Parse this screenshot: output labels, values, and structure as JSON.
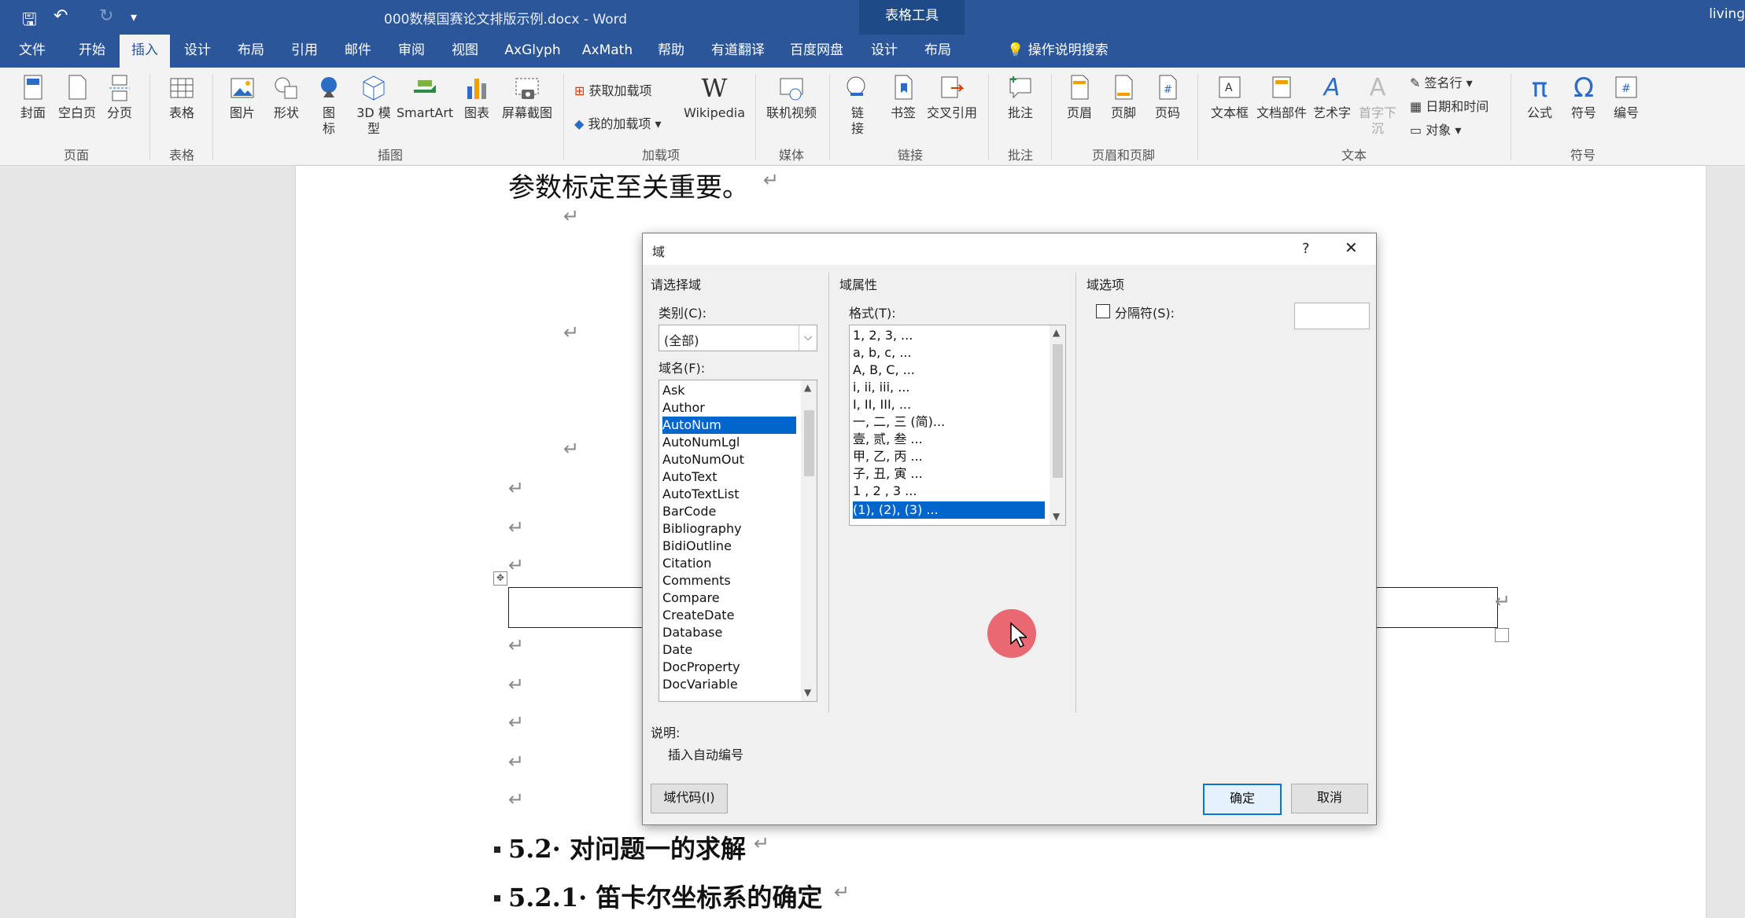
{
  "window": {
    "title": "000数模国赛论文排版示例.docx  -  Word",
    "context_tools": "表格工具",
    "user": "living"
  },
  "tabs": [
    "文件",
    "开始",
    "插入",
    "设计",
    "布局",
    "引用",
    "邮件",
    "审阅",
    "视图",
    "AxGlyph",
    "AxMath",
    "帮助",
    "有道翻译",
    "百度网盘",
    "设计",
    "布局"
  ],
  "active_tab": "插入",
  "tell_me": "操作说明搜索",
  "ribbon": {
    "cover": "封面",
    "blank_page": "空白页",
    "page_break": "分页",
    "table": "表格",
    "picture": "图片",
    "shapes": "形状",
    "icons": "图\n标",
    "models3d": "3D 模\n型",
    "smartart": "SmartArt",
    "chart": "图表",
    "screenshot": "屏幕截图",
    "get_addins": "获取加载项",
    "my_addins": "我的加载项",
    "wikipedia": "Wikipedia",
    "online_video": "联机视频",
    "link": "链\n接",
    "bookmark": "书签",
    "cross_ref": "交叉引用",
    "comment": "批注",
    "header": "页眉",
    "footer": "页脚",
    "page_number": "页码",
    "textbox": "文本框",
    "quick_parts": "文档部件",
    "wordart": "艺术字",
    "dropcap": "首字下沉",
    "signature_line": "签名行",
    "date_time": "日期和时间",
    "object": "对象",
    "equation": "公式",
    "symbol": "符号",
    "number": "编号",
    "groups": [
      "页面",
      "表格",
      "插图",
      "加载项",
      "媒体",
      "链接",
      "批注",
      "页眉和页脚",
      "文本",
      "符号"
    ]
  },
  "document": {
    "line1": "参数标定至关重要。",
    "heading1": "5.2· 对问题一的求解",
    "heading2": "5.2.1· 笛卡尔坐标系的确定"
  },
  "dialog": {
    "title": "域",
    "help": "?",
    "close": "✕",
    "choose_field": "请选择域",
    "category_label": "类别(C):",
    "category_value": "(全部)",
    "field_names_label": "域名(F):",
    "field_names": [
      "Ask",
      "Author",
      "AutoNum",
      "AutoNumLgl",
      "AutoNumOut",
      "AutoText",
      "AutoTextList",
      "BarCode",
      "Bibliography",
      "BidiOutline",
      "Citation",
      "Comments",
      "Compare",
      "CreateDate",
      "Database",
      "Date",
      "DocProperty",
      "DocVariable"
    ],
    "selected_field": "AutoNum",
    "field_props": "域属性",
    "format_label": "格式(T):",
    "formats": [
      "1, 2, 3, ...",
      "a, b, c, ...",
      "A, B, C, ...",
      "i, ii, iii, ...",
      "I, II, III, ...",
      "一, 二, 三 (简)...",
      "壹, 贰, 叁 ...",
      "甲, 乙, 丙 ...",
      "子, 丑, 寅 ...",
      "1 , 2 , 3  ...",
      "(1), (2), (3) ..."
    ],
    "selected_format": "(1), (2), (3) ...",
    "field_options": "域选项",
    "separator_label": "分隔符(S):",
    "separator_checked": false,
    "desc_label": "说明:",
    "desc_text": "插入自动编号",
    "field_codes_btn": "域代码(I)",
    "ok_btn": "确定",
    "cancel_btn": "取消"
  },
  "colors": {
    "accent": "#2b579a",
    "select": "#0066cc",
    "cursor_highlight": "#e8505b"
  }
}
